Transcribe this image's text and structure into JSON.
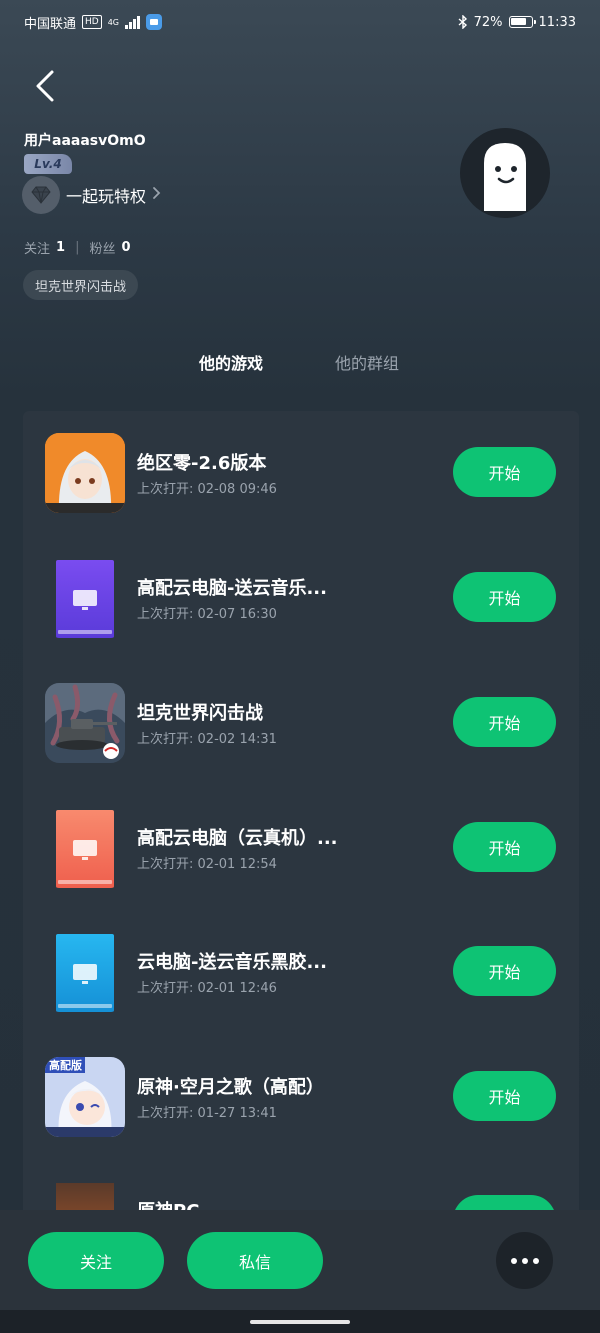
{
  "status_bar": {
    "carrier": "中国联通",
    "hd": "HD",
    "network": "4G",
    "battery": "72%",
    "time": "11:33"
  },
  "profile": {
    "username": "用户aaaasvOmO",
    "level": "Lv.4",
    "privilege_label": "一起玩特权",
    "following_label": "关注",
    "following_count": "1",
    "followers_label": "粉丝",
    "followers_count": "0",
    "tag": "坦克世界闪击战"
  },
  "tabs": [
    {
      "label": "他的游戏",
      "active": true
    },
    {
      "label": "他的群组",
      "active": false
    }
  ],
  "games": [
    {
      "title": "绝区零-2.6版本",
      "last_opened_label": "上次打开:",
      "last_opened": "02-08 09:46",
      "button": "开始",
      "icon": "zzz-character-icon"
    },
    {
      "title": "高配云电脑-送云音乐...",
      "last_opened_label": "上次打开:",
      "last_opened": "02-07 16:30",
      "button": "开始",
      "icon": "cloud-pc-purple-icon",
      "color": "#6b4de6"
    },
    {
      "title": "坦克世界闪击战",
      "last_opened_label": "上次打开:",
      "last_opened": "02-02 14:31",
      "button": "开始",
      "icon": "tank-kraken-icon"
    },
    {
      "title": "高配云电脑（云真机）...",
      "last_opened_label": "上次打开:",
      "last_opened": "02-01 12:54",
      "button": "开始",
      "icon": "cloud-pc-coral-icon",
      "color": "#f2735e"
    },
    {
      "title": "云电脑-送云音乐黑胶...",
      "last_opened_label": "上次打开:",
      "last_opened": "02-01 12:46",
      "button": "开始",
      "icon": "cloud-pc-blue-icon",
      "color": "#1aa6e8"
    },
    {
      "title": "原神·空月之歌（高配）",
      "last_opened_label": "上次打开:",
      "last_opened": "01-27 13:41",
      "button": "开始",
      "icon": "genshin-paimon-icon",
      "badge": "高配版"
    },
    {
      "title": "原神PC",
      "button": "开始",
      "icon": "genshin-pc-icon"
    }
  ],
  "actions": {
    "follow": "关注",
    "message": "私信"
  },
  "colors": {
    "accent": "#0ec374",
    "background": "#25303a",
    "card": "#2c3640"
  }
}
